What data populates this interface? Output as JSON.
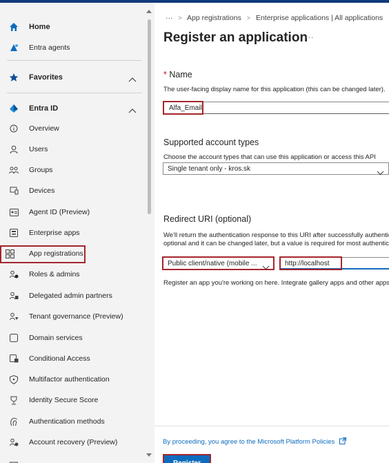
{
  "sidebar": {
    "items": [
      {
        "label": "Home",
        "icon": "home-icon",
        "bold": true
      },
      {
        "label": "Entra agents",
        "icon": "agents-icon"
      },
      {
        "label": "Favorites",
        "icon": "star-icon",
        "bold": true
      },
      {
        "label": "Entra ID",
        "icon": "entra-icon",
        "bold": true
      },
      {
        "label": "Overview",
        "icon": "info-icon"
      },
      {
        "label": "Users",
        "icon": "user-icon"
      },
      {
        "label": "Groups",
        "icon": "groups-icon"
      },
      {
        "label": "Devices",
        "icon": "devices-icon"
      },
      {
        "label": "Agent ID (Preview)",
        "icon": "agent-id-icon"
      },
      {
        "label": "Enterprise apps",
        "icon": "enterprise-apps-icon"
      },
      {
        "label": "App registrations",
        "icon": "app-registrations-icon"
      },
      {
        "label": "Roles & admins",
        "icon": "roles-icon"
      },
      {
        "label": "Delegated admin partners",
        "icon": "partners-icon"
      },
      {
        "label": "Tenant governance (Preview)",
        "icon": "governance-icon"
      },
      {
        "label": "Domain services",
        "icon": "domain-icon"
      },
      {
        "label": "Conditional Access",
        "icon": "conditional-access-icon"
      },
      {
        "label": "Multifactor authentication",
        "icon": "mfa-icon"
      },
      {
        "label": "Identity Secure Score",
        "icon": "secure-score-icon"
      },
      {
        "label": "Authentication methods",
        "icon": "auth-methods-icon"
      },
      {
        "label": "Account recovery (Preview)",
        "icon": "account-recovery-icon"
      }
    ]
  },
  "breadcrumb": {
    "more": "···",
    "items": [
      "App registrations",
      "Enterprise applications | All applications"
    ]
  },
  "main": {
    "title": "Register an application",
    "title_more": "···",
    "name": {
      "required_mark": "*",
      "label": "Name",
      "help": "The user-facing display name for this application (this can be changed later).",
      "value": "Alfa_Email"
    },
    "account_types": {
      "label": "Supported account types",
      "help": "Choose the account types that can use this application or access this API",
      "selected": "Single tenant only - kros.sk"
    },
    "redirect": {
      "label": "Redirect URI (optional)",
      "help_line1": "We'll return the authentication response to this URI after successfully authenticating the user. Providing this now is",
      "help_line2": "optional and it can be changed later, but a value is required for most authentication scenarios.",
      "platform": "Public client/native (mobile ...",
      "uri": "http://localhost",
      "note": "Register an app you're working on here. Integrate gallery apps and other apps from outside your organization"
    },
    "policy": "By proceeding, you agree to the Microsoft Platform Policies",
    "register": "Register"
  },
  "colors": {
    "accent": "#0f6cbd",
    "highlight": "#a4262c",
    "sidebar_bg": "#f3f3f3"
  }
}
